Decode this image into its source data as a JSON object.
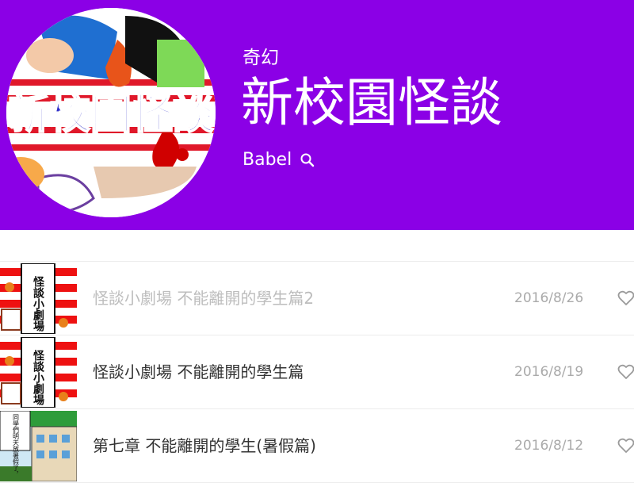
{
  "header": {
    "genre": "奇幻",
    "title": "新校園怪談",
    "author": "Babel",
    "cover_text": "新校園怪談",
    "background_color": "#8b00e6"
  },
  "episodes": [
    {
      "title": "怪談小劇場 不能離開的學生篇2",
      "date": "2016/8/26",
      "thumb_text": "怪談小劇場",
      "state": "read"
    },
    {
      "title": "怪談小劇場 不能離開的學生篇",
      "date": "2016/8/19",
      "thumb_text": "怪談小劇場",
      "state": "unread"
    },
    {
      "title": "第七章 不能離開的學生(暑假篇)",
      "date": "2016/8/12",
      "thumb_text": "同學們明天放暑假了，",
      "state": "unread"
    }
  ],
  "icons": {
    "search": "search-icon",
    "like": "heart-outline-icon"
  }
}
